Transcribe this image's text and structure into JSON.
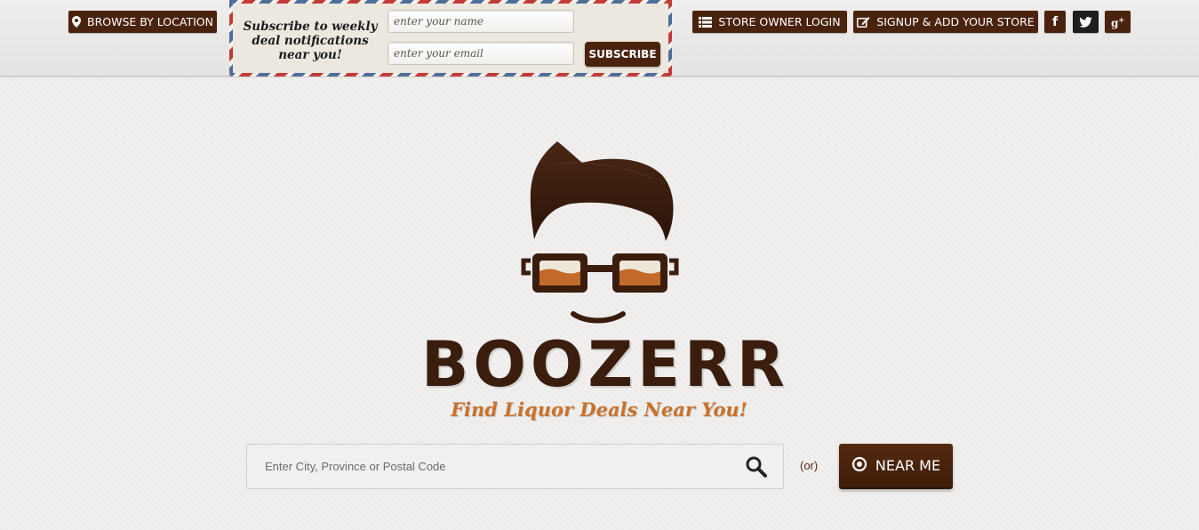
{
  "topbar": {
    "browse_label": "BROWSE BY LOCATION",
    "owner_login_label": "STORE OWNER LOGIN",
    "signup_label": "SIGNUP & ADD YOUR STORE",
    "social": [
      {
        "name": "facebook",
        "glyph": "f"
      },
      {
        "name": "twitter",
        "glyph": "twitter-bird"
      },
      {
        "name": "google-plus",
        "glyph": "g+"
      }
    ]
  },
  "subscribe": {
    "text": "Subscribe to weekly deal notifications near you!",
    "name_placeholder": "enter your name",
    "email_placeholder": "enter your email",
    "button_label": "SUBSCRIBE"
  },
  "brand": {
    "name": "BOOZERR",
    "tagline": "Find Liquor Deals Near You!"
  },
  "search": {
    "placeholder": "Enter City, Province or Postal Code",
    "or_text": "(or)",
    "near_me_label": "NEAR ME"
  },
  "colors": {
    "brand_brown": "#4a230f",
    "accent_orange": "#c9722c",
    "envelope_red": "#c43a3a",
    "envelope_blue": "#4f6e9c"
  }
}
